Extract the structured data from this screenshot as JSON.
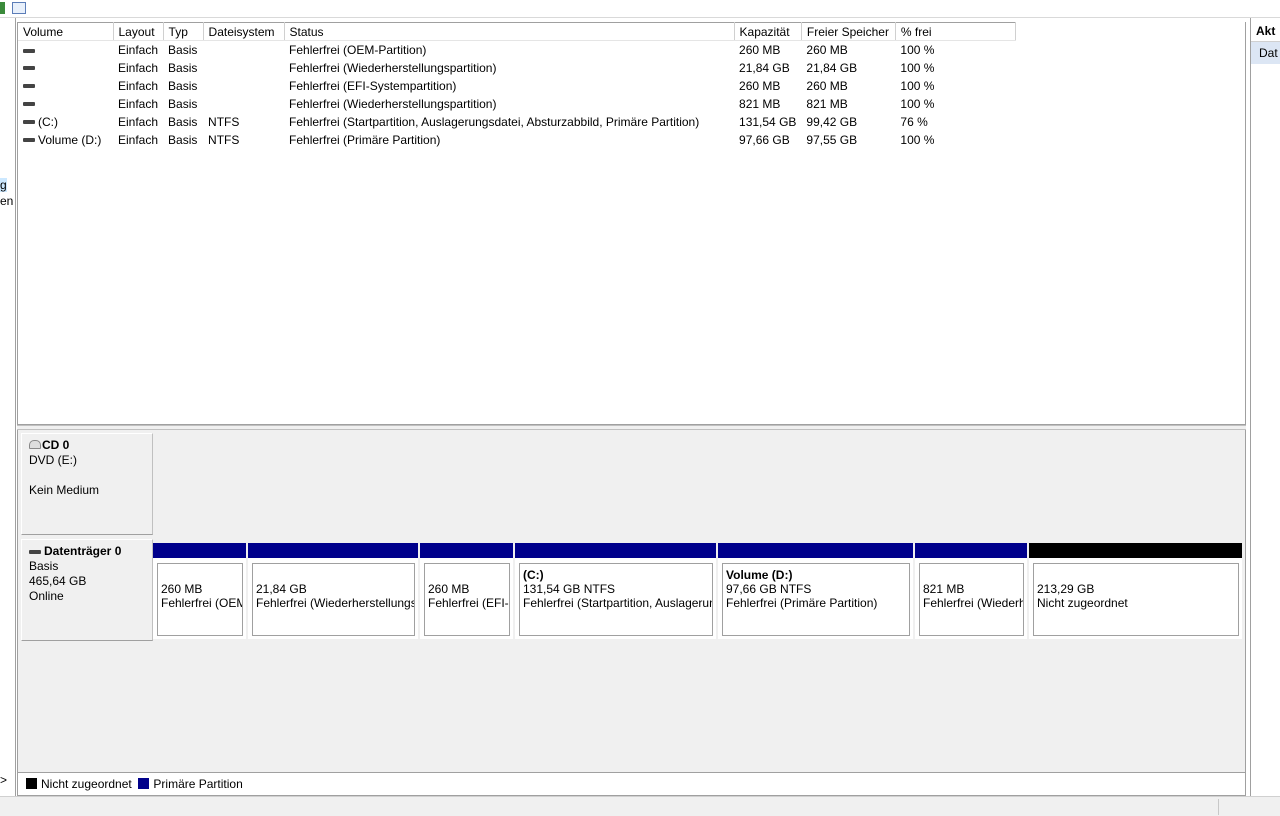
{
  "left_nav": {
    "items": [
      "g",
      "en"
    ],
    "scroll_arrow": ">"
  },
  "volume_table": {
    "columns": [
      "Volume",
      "Layout",
      "Typ",
      "Dateisystem",
      "Status",
      "Kapazität",
      "Freier Speicher",
      "% frei"
    ],
    "rows": [
      {
        "volume": "",
        "layout": "Einfach",
        "typ": "Basis",
        "fs": "",
        "status": "Fehlerfrei (OEM-Partition)",
        "cap": "260 MB",
        "free": "260 MB",
        "pct": "100 %"
      },
      {
        "volume": "",
        "layout": "Einfach",
        "typ": "Basis",
        "fs": "",
        "status": "Fehlerfrei (Wiederherstellungspartition)",
        "cap": "21,84 GB",
        "free": "21,84 GB",
        "pct": "100 %"
      },
      {
        "volume": "",
        "layout": "Einfach",
        "typ": "Basis",
        "fs": "",
        "status": "Fehlerfrei (EFI-Systempartition)",
        "cap": "260 MB",
        "free": "260 MB",
        "pct": "100 %"
      },
      {
        "volume": "",
        "layout": "Einfach",
        "typ": "Basis",
        "fs": "",
        "status": "Fehlerfrei (Wiederherstellungspartition)",
        "cap": "821 MB",
        "free": "821 MB",
        "pct": "100 %"
      },
      {
        "volume": "(C:)",
        "layout": "Einfach",
        "typ": "Basis",
        "fs": "NTFS",
        "status": "Fehlerfrei (Startpartition, Auslagerungsdatei, Absturzabbild, Primäre Partition)",
        "cap": "131,54 GB",
        "free": "99,42 GB",
        "pct": "76 %"
      },
      {
        "volume": "Volume (D:)",
        "layout": "Einfach",
        "typ": "Basis",
        "fs": "NTFS",
        "status": "Fehlerfrei (Primäre Partition)",
        "cap": "97,66 GB",
        "free": "97,55 GB",
        "pct": "100 %"
      }
    ]
  },
  "cd": {
    "title": "CD 0",
    "line1": "DVD (E:)",
    "line2": "Kein Medium"
  },
  "disk0": {
    "title": "Datenträger 0",
    "type": "Basis",
    "size": "465,64 GB",
    "state": "Online",
    "partitions": [
      {
        "title": "",
        "size": "260 MB",
        "status": "Fehlerfrei (OEM-Partition)",
        "kind": "primary"
      },
      {
        "title": "",
        "size": "21,84 GB",
        "status": "Fehlerfrei (Wiederherstellungspartition)",
        "kind": "primary"
      },
      {
        "title": "",
        "size": "260 MB",
        "status": "Fehlerfrei (EFI-Systempartition)",
        "kind": "primary"
      },
      {
        "title": "(C:)",
        "size": "131,54 GB NTFS",
        "status": "Fehlerfrei (Startpartition, Auslagerungsdatei, Absturzabbild, Primäre Partition)",
        "kind": "primary"
      },
      {
        "title": "Volume  (D:)",
        "size": "97,66 GB NTFS",
        "status": "Fehlerfrei (Primäre Partition)",
        "kind": "primary"
      },
      {
        "title": "",
        "size": "821 MB",
        "status": "Fehlerfrei (Wiederherstellungspartition)",
        "kind": "primary"
      },
      {
        "title": "",
        "size": "213,29 GB",
        "status": "Nicht zugeordnet",
        "kind": "unallocated"
      }
    ]
  },
  "legend": {
    "unallocated": "Nicht zugeordnet",
    "primary": "Primäre Partition"
  },
  "actions": {
    "header": "Akt",
    "item": "Dat"
  },
  "colors": {
    "primary": "#00008b",
    "unallocated": "#000000"
  }
}
